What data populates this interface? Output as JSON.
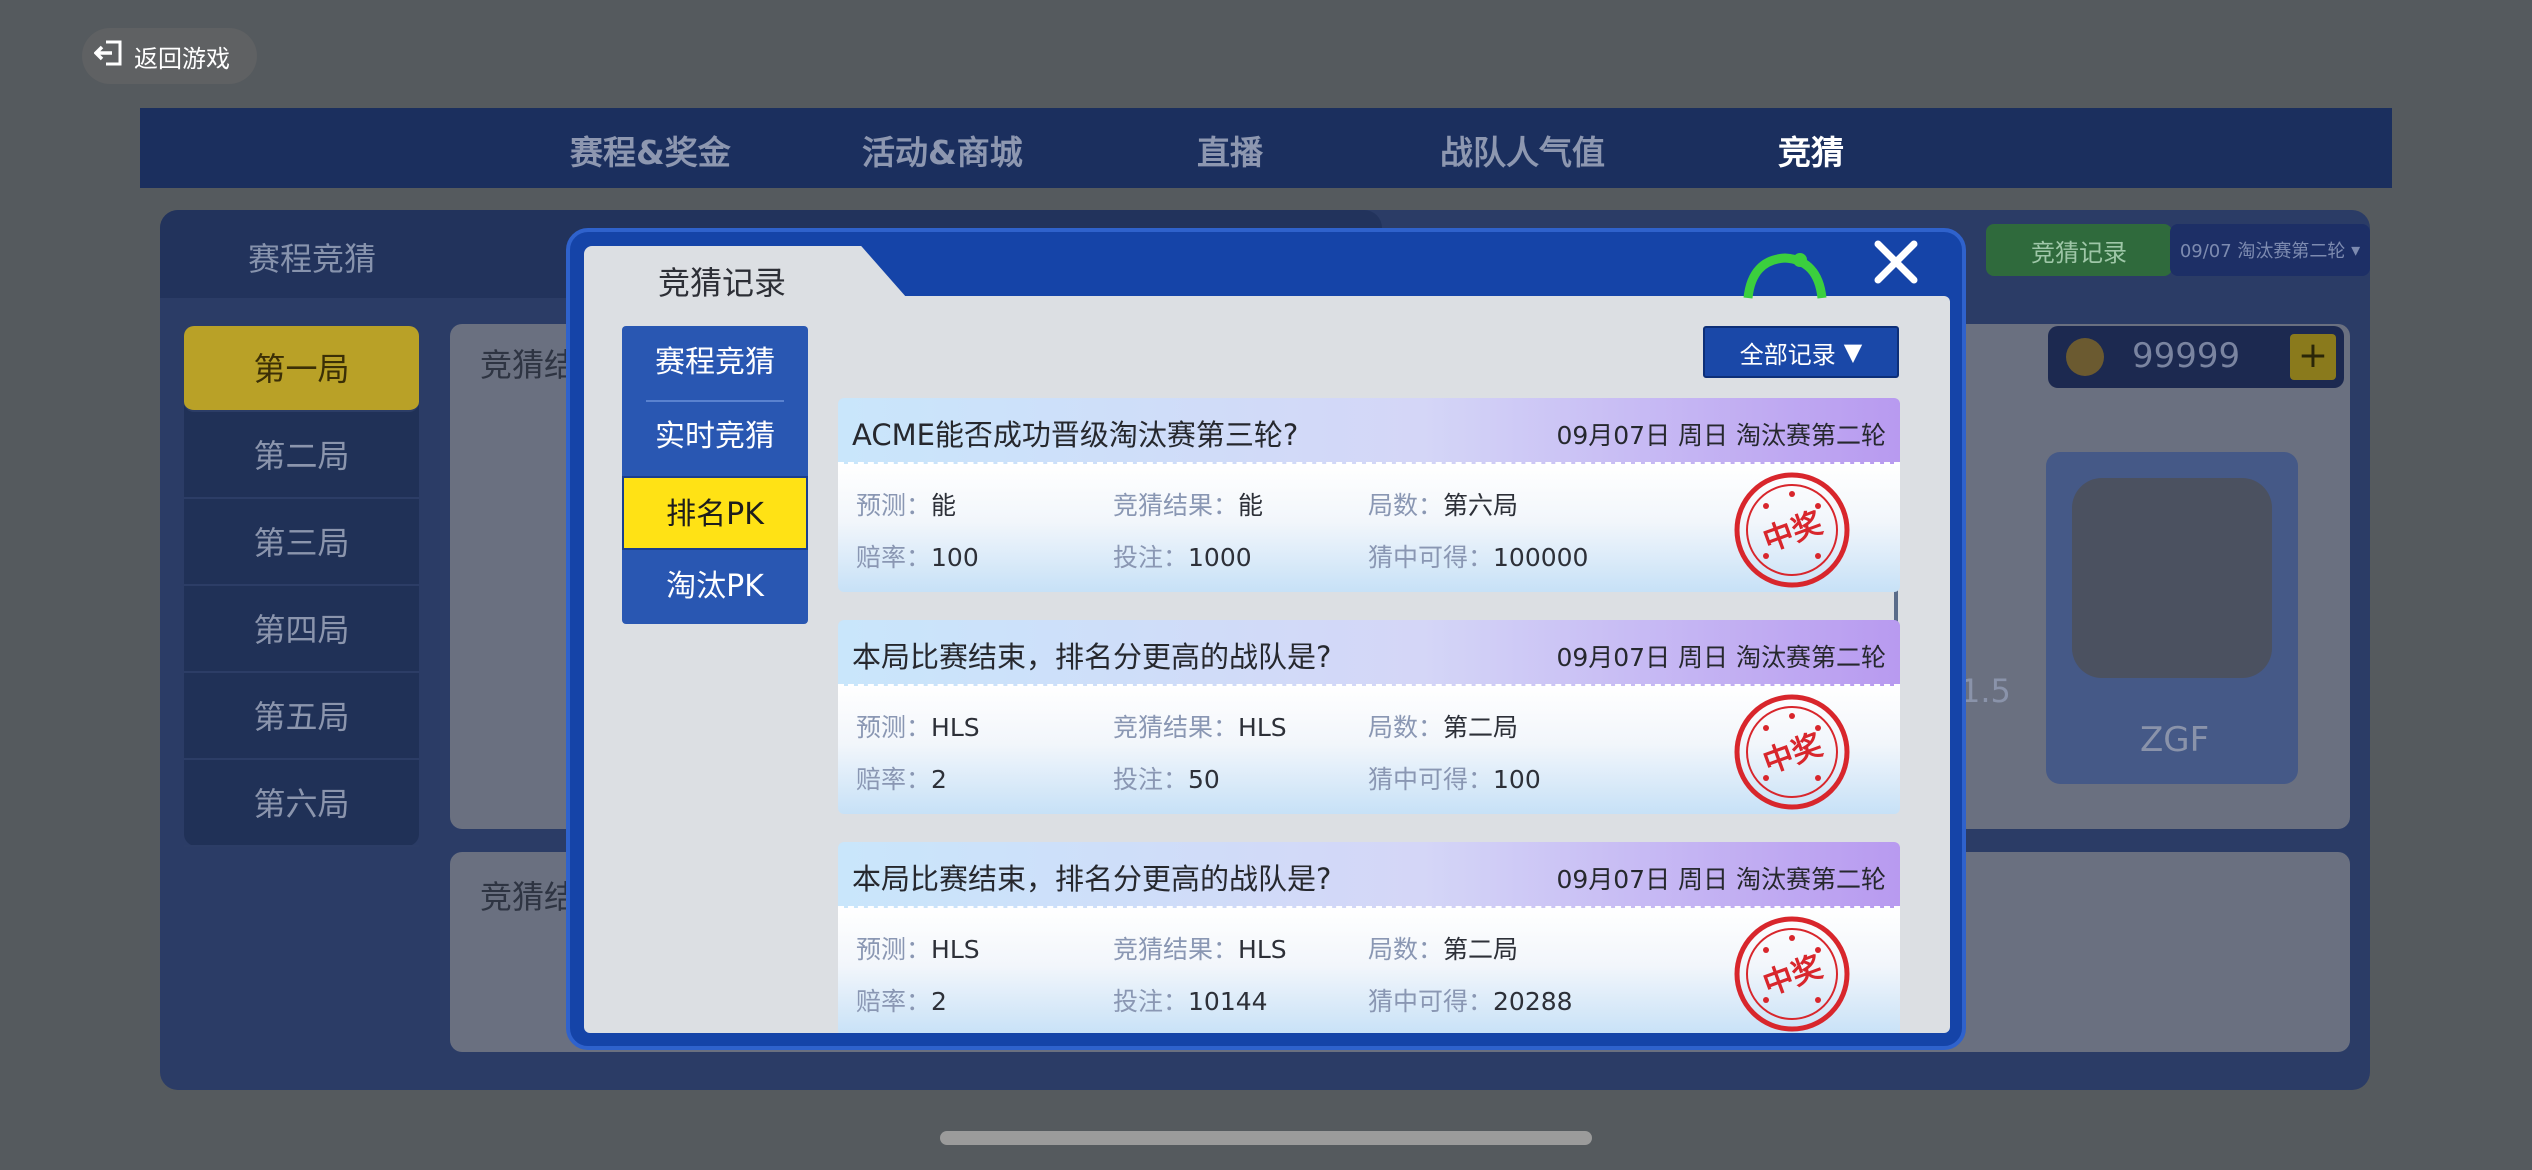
{
  "back_button": {
    "label": "返回游戏"
  },
  "top_nav": {
    "tabs": [
      {
        "label": "赛程&奖金"
      },
      {
        "label": "活动&商城"
      },
      {
        "label": "直播"
      },
      {
        "label": "战队人气值"
      },
      {
        "label": "竞猜"
      }
    ],
    "active_tab": "竞猜"
  },
  "background_page": {
    "subhead": "赛程竞猜",
    "rounds": [
      "第一局",
      "第二局",
      "第三局",
      "第四局",
      "第五局",
      "第六局"
    ],
    "active_round": "第一局",
    "card_headings": [
      "竞猜结",
      "竞猜结"
    ],
    "record_button": "竞猜记录",
    "stage_select": "09/07 淘汰赛第二轮",
    "coin_balance": "99999",
    "team_name": "ZGF",
    "odds_fragment": "1.5"
  },
  "modal": {
    "title": "竞猜记录",
    "menu": [
      {
        "label": "赛程竞猜"
      },
      {
        "label": "实时竞猜"
      },
      {
        "label": "排名PK"
      },
      {
        "label": "淘汰PK"
      }
    ],
    "active_menu": "排名PK",
    "filter_label": "全部记录",
    "field_labels": {
      "prediction": "预测：",
      "result": "竞猜结果：",
      "round": "局数：",
      "odds": "赔率：",
      "stake": "投注：",
      "winnings": "猜中可得："
    },
    "stamp_text": "中奖",
    "records": [
      {
        "question": "ACME能否成功晋级淘汰赛第三轮?",
        "date": "09月07日 周日 淘汰赛第二轮",
        "prediction": "能",
        "result": "能",
        "round": "第六局",
        "odds": "100",
        "stake": "1000",
        "winnings": "100000"
      },
      {
        "question": "本局比赛结束，排名分更高的战队是?",
        "date": "09月07日 周日 淘汰赛第二轮",
        "prediction": "HLS",
        "result": "HLS",
        "round": "第二局",
        "odds": "2",
        "stake": "50",
        "winnings": "100"
      },
      {
        "question": "本局比赛结束，排名分更高的战队是?",
        "date": "09月07日 周日 淘汰赛第二轮",
        "prediction": "HLS",
        "result": "HLS",
        "round": "第二局",
        "odds": "2",
        "stake": "10144",
        "winnings": "20288"
      }
    ]
  },
  "colors": {
    "modal_blue": "#1544a8",
    "active_yellow": "#ffe215",
    "stamp_red": "#d8262c"
  }
}
